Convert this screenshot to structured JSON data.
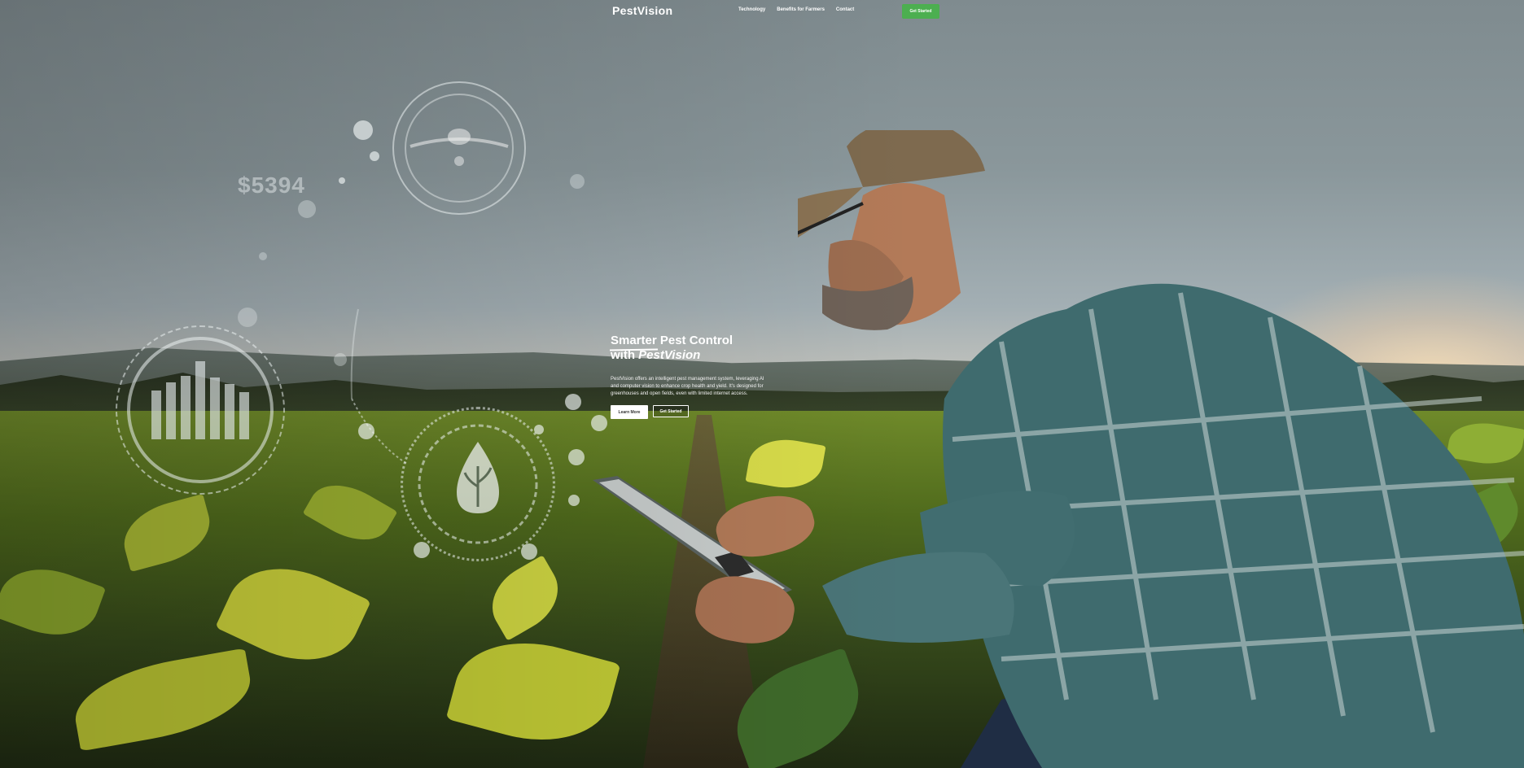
{
  "brand": {
    "logo_text": "PestVision"
  },
  "nav": {
    "items": [
      {
        "label": "Technology"
      },
      {
        "label": "Benefits for Farmers"
      },
      {
        "label": "Contact"
      }
    ],
    "cta_label": "Get Started"
  },
  "hero": {
    "title_line1_underlined": "Smarter",
    "title_line1_rest": " Pest Control",
    "title_line2_prefix": "with ",
    "title_line2_brand": "PestVision",
    "description": "PestVision offers an intelligent pest management system, leveraging AI and computer vision to enhance crop health and yield. It's designed for greenhouses and open fields, even with limited internet access.",
    "learn_more_label": "Learn More",
    "get_started_label": "Get Started"
  },
  "overlay": {
    "price_text": "$5394",
    "icons": [
      "drone-icon",
      "bar-chart-icon",
      "plant-drop-icon"
    ]
  },
  "colors": {
    "accent": "#4caf50",
    "text": "#ffffff"
  }
}
